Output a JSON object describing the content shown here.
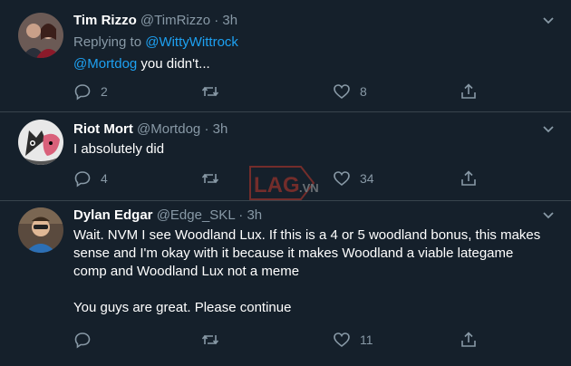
{
  "tweets": [
    {
      "name": "Tim Rizzo",
      "handle": "@TimRizzo",
      "time": "3h",
      "replying_prefix": "Replying to ",
      "replying_to": "@WittyWittrock",
      "mention": "@Mortdog",
      "text": " you didn't...",
      "replies": "2",
      "retweets": "",
      "likes": "8"
    },
    {
      "name": "Riot Mort",
      "handle": "@Mortdog",
      "time": "3h",
      "text": "I absolutely did",
      "replies": "4",
      "retweets": "",
      "likes": "34"
    },
    {
      "name": "Dylan Edgar",
      "handle": "@Edge_SKL",
      "time": "3h",
      "text_line1": "Wait. NVM I see Woodland Lux. If this is a 4 or 5 woodland bonus, this makes",
      "text_line2": "sense and I'm okay with it because it makes Woodland a viable lategame",
      "text_line3": "comp and Woodland Lux not a meme",
      "text_line4": "You guys are great. Please continue",
      "replies": "",
      "retweets": "",
      "likes": "11"
    }
  ],
  "separator": "·",
  "watermark": "LAG.VN"
}
